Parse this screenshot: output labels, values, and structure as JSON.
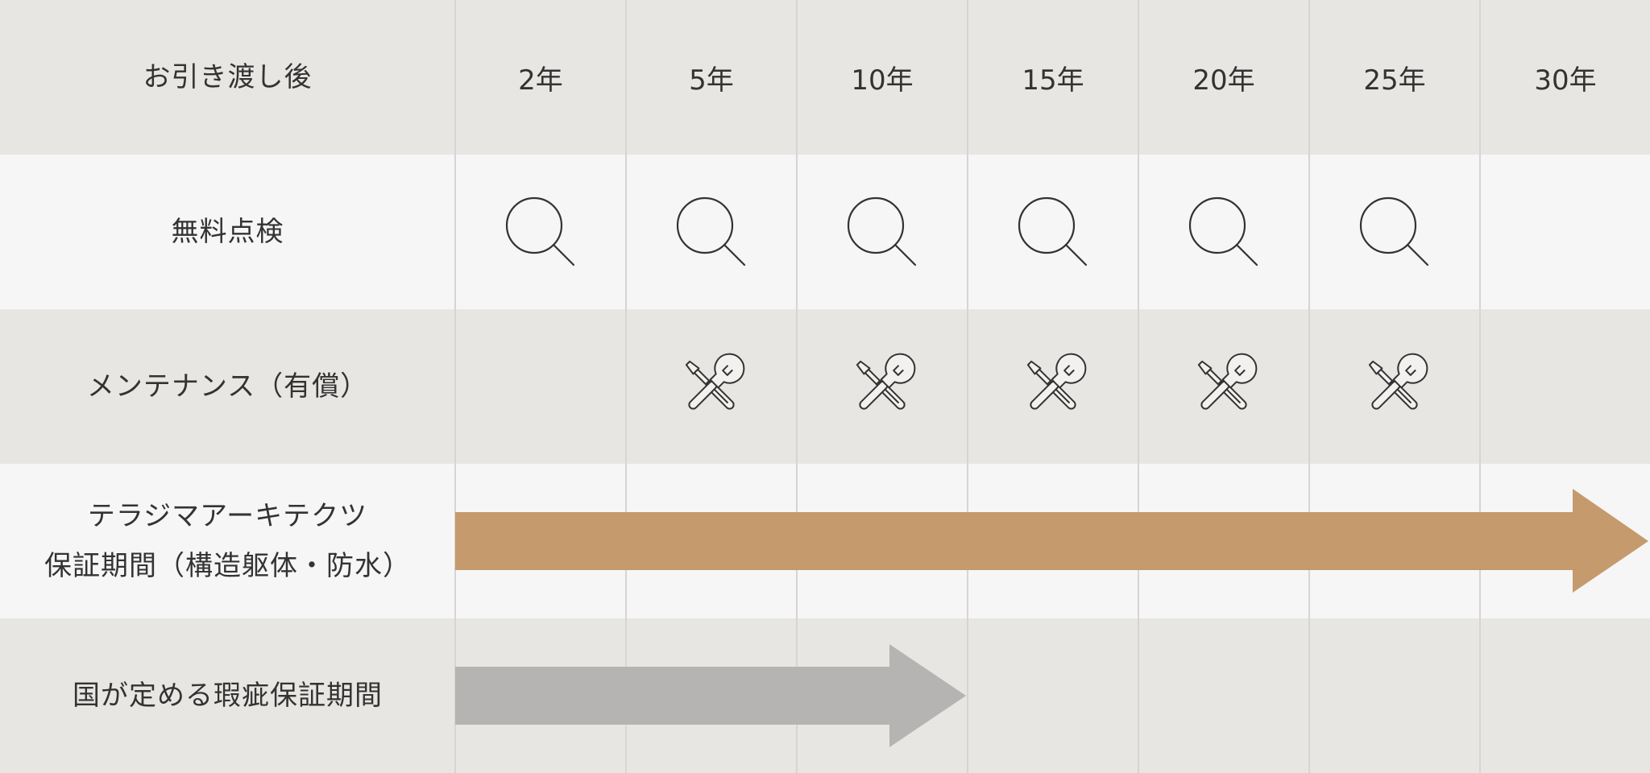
{
  "header": {
    "label": "お引き渡し後",
    "years": [
      "2年",
      "5年",
      "10年",
      "15年",
      "20年",
      "25年",
      "30年"
    ]
  },
  "rows": {
    "inspection": {
      "label": "無料点検",
      "icon": "search-icon",
      "marks": [
        true,
        true,
        true,
        true,
        true,
        true,
        false
      ]
    },
    "maintenance": {
      "label": "メンテナンス（有償）",
      "icon": "tools-icon",
      "marks": [
        false,
        true,
        true,
        true,
        true,
        true,
        false
      ]
    },
    "terajima_warranty": {
      "label_line1": "テラジマアーキテクツ",
      "label_line2": "保証期間（構造躯体・防水）",
      "color": "#c59a6c"
    },
    "legal_warranty": {
      "label": "国が定める瑕疵保証期間",
      "color": "#b5b4b2"
    }
  },
  "colors": {
    "header_bg": "#e8e6e3",
    "light_bg": "#f6f6f6",
    "grid_line": "#d6d5d3",
    "text": "#333333"
  }
}
